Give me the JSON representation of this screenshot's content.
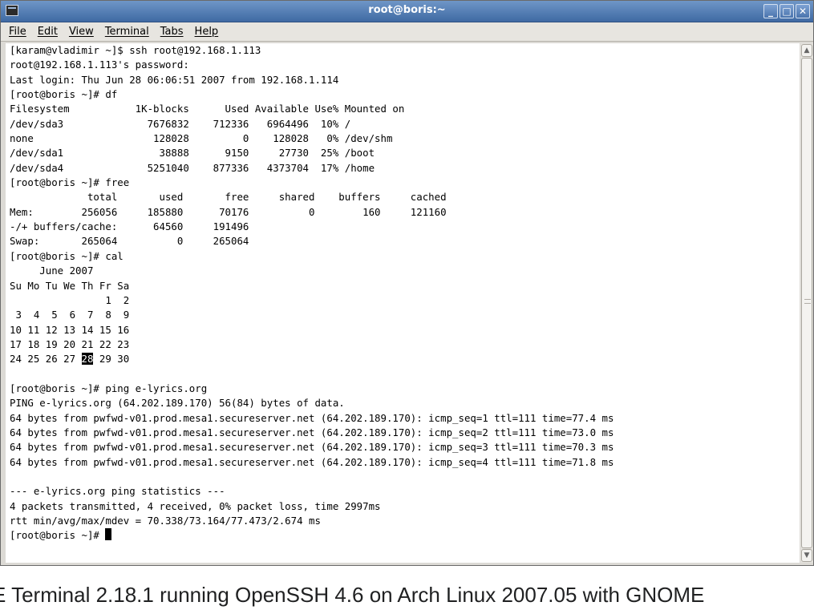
{
  "window": {
    "title": "root@boris:~",
    "icon": "terminal-icon",
    "controls": {
      "minimize": "_",
      "maximize": "□",
      "close": "✕"
    }
  },
  "menubar": {
    "items": [
      "File",
      "Edit",
      "View",
      "Terminal",
      "Tabs",
      "Help"
    ]
  },
  "terminal": {
    "lines": [
      "[karam@vladimir ~]$ ssh root@192.168.1.113",
      "root@192.168.1.113's password:",
      "Last login: Thu Jun 28 06:06:51 2007 from 192.168.1.114",
      "[root@boris ~]# df",
      "Filesystem           1K-blocks      Used Available Use% Mounted on",
      "/dev/sda3              7676832    712336   6964496  10% /",
      "none                    128028         0    128028   0% /dev/shm",
      "/dev/sda1                38888      9150     27730  25% /boot",
      "/dev/sda4              5251040    877336   4373704  17% /home",
      "[root@boris ~]# free",
      "             total       used       free     shared    buffers     cached",
      "Mem:        256056     185880      70176          0        160     121160",
      "-/+ buffers/cache:      64560     191496",
      "Swap:       265064          0     265064",
      "[root@boris ~]# cal",
      "     June 2007",
      "Su Mo Tu We Th Fr Sa",
      "                1  2",
      " 3  4  5  6  7  8  9",
      "10 11 12 13 14 15 16",
      "17 18 19 20 21 22 23",
      "24 25 26 27 ",
      "",
      "[root@boris ~]# ping e-lyrics.org",
      "PING e-lyrics.org (64.202.189.170) 56(84) bytes of data.",
      "64 bytes from pwfwd-v01.prod.mesa1.secureserver.net (64.202.189.170): icmp_seq=1 ttl=111 time=77.4 ms",
      "64 bytes from pwfwd-v01.prod.mesa1.secureserver.net (64.202.189.170): icmp_seq=2 ttl=111 time=73.0 ms",
      "64 bytes from pwfwd-v01.prod.mesa1.secureserver.net (64.202.189.170): icmp_seq=3 ttl=111 time=70.3 ms",
      "64 bytes from pwfwd-v01.prod.mesa1.secureserver.net (64.202.189.170): icmp_seq=4 ttl=111 time=71.8 ms",
      "",
      "--- e-lyrics.org ping statistics ---",
      "4 packets transmitted, 4 received, 0% packet loss, time 2997ms",
      "rtt min/avg/max/mdev = 70.338/73.164/77.473/2.674 ms",
      "[root@boris ~]# "
    ],
    "calendar_highlight": "28",
    "calendar_tail": " 29 30"
  },
  "caption": {
    "text": "E Terminal 2.18.1 running OpenSSH 4.6 on Arch Linux 2007.05 with GNOME"
  }
}
